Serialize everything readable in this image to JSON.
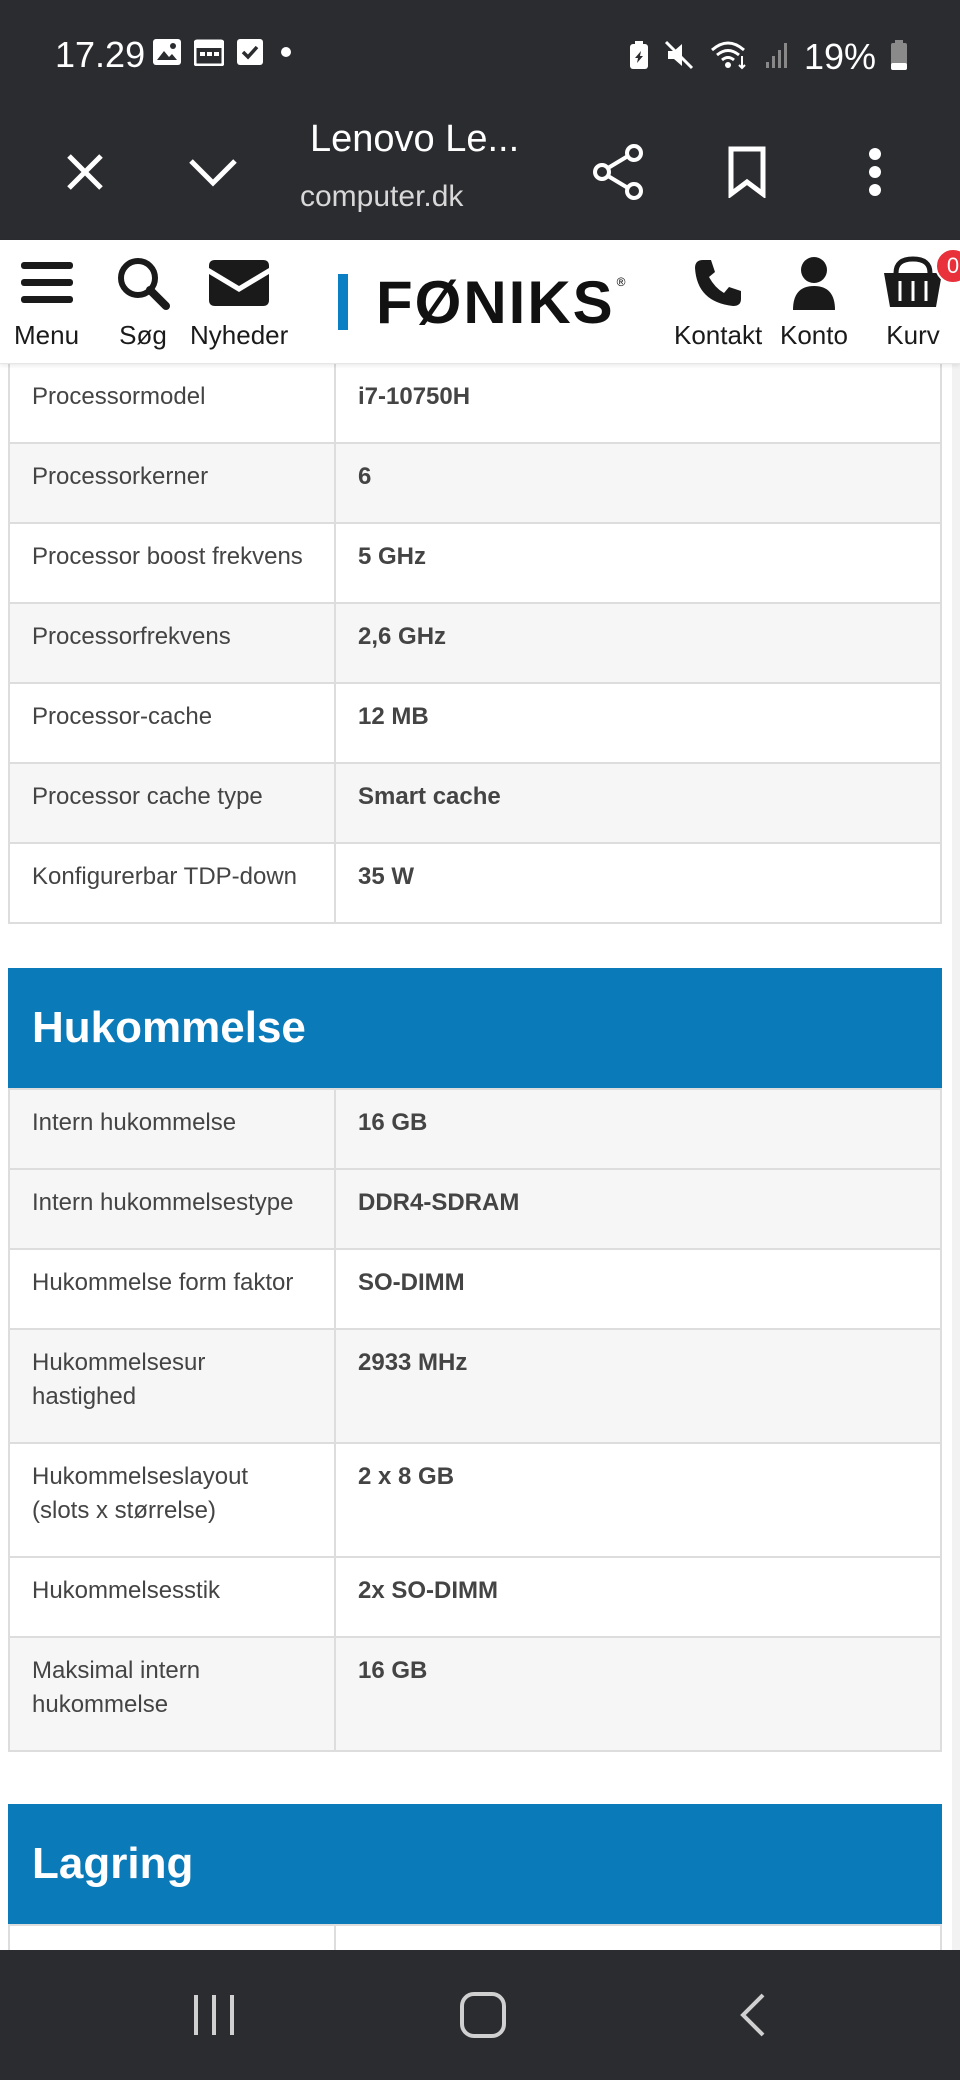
{
  "status": {
    "time": "17.29",
    "battery": "19%"
  },
  "browser": {
    "tab_title": "Lenovo Le...",
    "url": "computer.dk"
  },
  "header": {
    "menu_label": "Menu",
    "search_label": "Søg",
    "news_label": "Nyheder",
    "logo": "FØNIKS",
    "contact_label": "Kontakt",
    "account_label": "Konto",
    "cart_label": "Kurv",
    "cart_count": "0"
  },
  "processor_rows": [
    {
      "label": "Processormodel",
      "value": "i7-10750H"
    },
    {
      "label": "Processorkerner",
      "value": "6"
    },
    {
      "label": "Processor boost frekvens",
      "value": "5 GHz"
    },
    {
      "label": "Processorfrekvens",
      "value": "2,6 GHz"
    },
    {
      "label": "Processor-cache",
      "value": "12 MB"
    },
    {
      "label": "Processor cache type",
      "value": "Smart cache"
    },
    {
      "label": "Konfigurerbar TDP-down",
      "value": "35 W"
    }
  ],
  "memory": {
    "title": "Hukommelse",
    "rows": [
      {
        "label": "Intern hukommelse",
        "value": "16 GB"
      },
      {
        "label": "Intern hukommelsestype",
        "value": "DDR4-SDRAM"
      },
      {
        "label": "Hukommelse form faktor",
        "value": "SO-DIMM"
      },
      {
        "label": "Hukommelsesur hastighed",
        "value": "2933 MHz"
      },
      {
        "label": "Hukommelseslayout (slots x størrelse)",
        "value": "2 x 8 GB"
      },
      {
        "label": "Hukommelsesstik",
        "value": "2x SO-DIMM"
      },
      {
        "label": "Maksimal intern hukommelse",
        "value": "16 GB"
      }
    ]
  },
  "storage": {
    "title": "Lagring"
  },
  "colors": {
    "section_blue": "#0a7ab8",
    "logo_bar": "#0a7fc4",
    "badge_red": "#e8313a"
  }
}
